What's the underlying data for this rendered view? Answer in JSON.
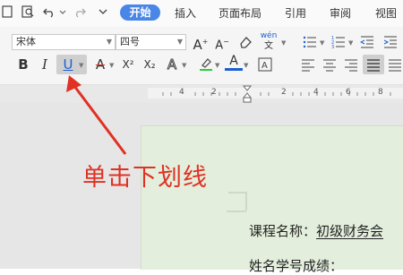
{
  "menubar": {
    "tabs": [
      "开始",
      "插入",
      "页面布局",
      "引用",
      "审阅",
      "视图"
    ],
    "icons": [
      "file-icon",
      "print-preview-icon",
      "undo-icon",
      "undo-dropdown-icon",
      "redo-icon",
      "more-icon"
    ]
  },
  "toolbar": {
    "font_family": "宋体",
    "font_size": "四号",
    "bold": "B",
    "italic": "I",
    "underline": "U",
    "superscript": "X²",
    "subscript": "X₂",
    "text_effect": "A",
    "font_color_label": "A",
    "pinyin_label": "wén",
    "highlight_color": "#2ecc40",
    "font_color": "#1a5fd1"
  },
  "ruler": {
    "numbers": [
      "4",
      "2",
      "2",
      "4",
      "6",
      "8"
    ]
  },
  "document": {
    "line1_label": "课程名称：",
    "line1_underlined": "初级财务会",
    "line2": "姓名学号成绩："
  },
  "annotation": {
    "text": "单击下划线",
    "color": "#e03124"
  }
}
